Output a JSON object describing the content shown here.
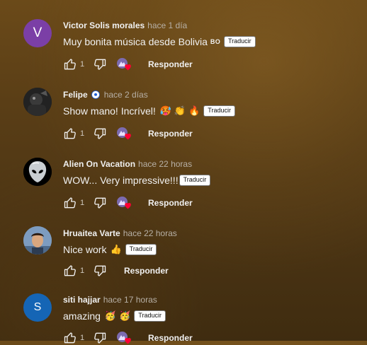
{
  "actions": {
    "reply_label": "Responder",
    "translate_label": "Traducir"
  },
  "comments": [
    {
      "author": "Victor Solis morales",
      "time": "hace 1 día",
      "avatar_letter": "V",
      "avatar_color": "#7b3fa6",
      "text": "Muy bonita música desde Bolivia",
      "text_suffix": "BO",
      "likes": "1",
      "creator_heart": true
    },
    {
      "author": "Felipe",
      "time": "hace 2 días",
      "avatar_letter": "",
      "badge_icon": "soccer-ball-icon",
      "text": "Show mano! Incrível!",
      "emojis": [
        "🥵",
        "👏",
        "🔥"
      ],
      "likes": "1",
      "creator_heart": true
    },
    {
      "author": "Alien On Vacation",
      "time": "hace 22 horas",
      "avatar_letter": "",
      "text": "WOW... Very impressive!!!",
      "likes": "1",
      "creator_heart": true
    },
    {
      "author": "Hruaitea Varte",
      "time": "hace 22 horas",
      "avatar_letter": "",
      "text": "Nice work",
      "emojis": [
        "👍"
      ],
      "likes": "1",
      "creator_heart": false
    },
    {
      "author": "siti hajjar",
      "time": "hace 17 horas",
      "avatar_letter": "S",
      "avatar_color": "#1565b5",
      "text": "amazing",
      "emojis": [
        "🥳",
        "🥳"
      ],
      "likes": "1",
      "creator_heart": true
    }
  ]
}
